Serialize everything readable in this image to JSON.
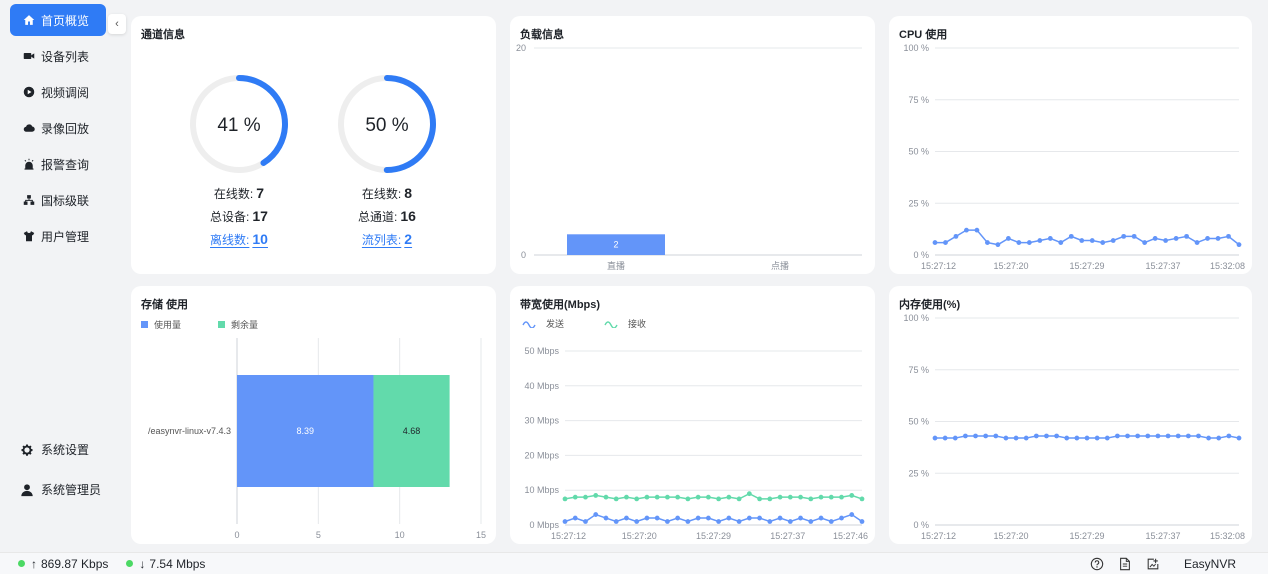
{
  "sidebar": {
    "items": [
      {
        "label": "首页概览",
        "icon": "home-icon",
        "active": true
      },
      {
        "label": "设备列表",
        "icon": "camera-icon",
        "active": false
      },
      {
        "label": "视频调阅",
        "icon": "play-icon",
        "active": false
      },
      {
        "label": "录像回放",
        "icon": "cloud-icon",
        "active": false
      },
      {
        "label": "报警查询",
        "icon": "alarm-icon",
        "active": false
      },
      {
        "label": "国标级联",
        "icon": "cascade-icon",
        "active": false
      },
      {
        "label": "用户管理",
        "icon": "shirt-icon",
        "active": false
      }
    ],
    "collapse_icon": "chevron-left-icon",
    "bottom": [
      {
        "label": "系统设置",
        "icon": "gear-icon"
      },
      {
        "label": "系统管理员",
        "icon": "user-icon"
      }
    ]
  },
  "channel": {
    "title": "通道信息",
    "online_percent": 41,
    "online_percent_label": "41 %",
    "stream_percent": 50,
    "stream_percent_label": "50 %",
    "online_label": "在线数:",
    "online_value": "7",
    "total_devices_label": "总设备:",
    "total_devices_value": "17",
    "offline_label": "离线数:",
    "offline_value": "10",
    "online2_label": "在线数:",
    "online2_value": "8",
    "total_channels_label": "总通道:",
    "total_channels_value": "16",
    "stream_list_label": "流列表:",
    "stream_list_value": "2"
  },
  "load": {
    "title": "负载信息"
  },
  "cpu": {
    "title": "CPU 使用"
  },
  "storage": {
    "title": "存储 使用",
    "legend_used": "使用量",
    "legend_free": "剩余量"
  },
  "bandwidth": {
    "title": "带宽使用(Mbps)",
    "legend_send": "发送",
    "legend_recv": "接收"
  },
  "memory": {
    "title": "内存使用(%)"
  },
  "colors": {
    "primary": "#2f7bf5",
    "bar_blue": "#6395f9",
    "green": "#62daab",
    "ring_bg": "#eeeeee",
    "status_dot": "#4cd964"
  },
  "status": {
    "up_arrow": "↑",
    "upload": "869.87 Kbps",
    "down_arrow": "↓",
    "download": "7.54 Mbps",
    "icons": [
      "help-icon",
      "document-icon",
      "export-icon"
    ],
    "brand": "EasyNVR"
  },
  "chart_data": [
    {
      "name": "load",
      "type": "bar",
      "categories": [
        "直播",
        "点播"
      ],
      "values": [
        2,
        0
      ],
      "data_labels": [
        "2",
        ""
      ],
      "ylim": [
        0,
        20
      ],
      "yticks": [
        "0",
        "20"
      ]
    },
    {
      "name": "cpu",
      "type": "line",
      "x": [
        "15:27:12",
        "15:27:20",
        "15:27:29",
        "15:27:37",
        "15:32:08"
      ],
      "values": [
        6,
        6,
        9,
        12,
        12,
        6,
        5,
        8,
        6,
        6,
        7,
        8,
        6,
        9,
        7,
        7,
        6,
        7,
        9,
        9,
        6,
        8,
        7,
        8,
        9,
        6,
        8,
        8,
        9,
        5
      ],
      "ylim": [
        0,
        100
      ],
      "yticks": [
        "0 %",
        "25 %",
        "50 %",
        "75 %",
        "100 %"
      ],
      "grid": true
    },
    {
      "name": "storage",
      "type": "bar",
      "orientation": "horizontal",
      "stacked": true,
      "categories": [
        "/easynvr-linux-v7.4.3"
      ],
      "series": [
        {
          "name": "使用量",
          "values": [
            8.39
          ],
          "label": "8.39"
        },
        {
          "name": "剩余量",
          "values": [
            4.68
          ],
          "label": "4.68"
        }
      ],
      "xlim": [
        0,
        15
      ],
      "xticks": [
        "0",
        "5",
        "10",
        "15"
      ],
      "grid": true
    },
    {
      "name": "bandwidth",
      "type": "line",
      "x": [
        "15:27:12",
        "15:27:20",
        "15:27:29",
        "15:27:37",
        "15:27:46"
      ],
      "series": [
        {
          "name": "发送",
          "values": [
            1,
            2,
            1,
            3,
            2,
            1,
            2,
            1,
            2,
            2,
            1,
            2,
            1,
            2,
            2,
            1,
            2,
            1,
            2,
            2,
            1,
            2,
            1,
            2,
            1,
            2,
            1,
            2,
            3,
            1
          ]
        },
        {
          "name": "接收",
          "values": [
            7.5,
            8,
            8,
            8.5,
            8,
            7.5,
            8,
            7.5,
            8,
            8,
            8,
            8,
            7.5,
            8,
            8,
            7.5,
            8,
            7.5,
            9,
            7.5,
            7.5,
            8,
            8,
            8,
            7.5,
            8,
            8,
            8,
            8.5,
            7.5
          ]
        }
      ],
      "ylim": [
        0,
        50
      ],
      "yticks": [
        "0 Mbps",
        "10 Mbps",
        "20 Mbps",
        "30 Mbps",
        "40 Mbps",
        "50 Mbps"
      ],
      "grid": true
    },
    {
      "name": "memory",
      "type": "line",
      "x": [
        "15:27:12",
        "15:27:20",
        "15:27:29",
        "15:27:37",
        "15:32:08"
      ],
      "values": [
        42,
        42,
        42,
        43,
        43,
        43,
        43,
        42,
        42,
        42,
        43,
        43,
        43,
        42,
        42,
        42,
        42,
        42,
        43,
        43,
        43,
        43,
        43,
        43,
        43,
        43,
        43,
        42,
        42,
        43,
        42
      ],
      "ylim": [
        0,
        100
      ],
      "yticks": [
        "0 %",
        "25 %",
        "50 %",
        "75 %",
        "100 %"
      ],
      "grid": true
    }
  ]
}
